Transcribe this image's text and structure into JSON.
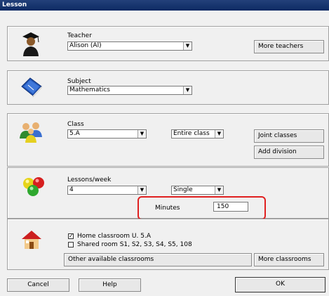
{
  "window": {
    "title": "Lesson"
  },
  "teacher": {
    "label": "Teacher",
    "selected": "Alison (Al)",
    "more_button": "More teachers",
    "icon": "teacher-icon"
  },
  "subject": {
    "label": "Subject",
    "selected": "Mathematics",
    "icon": "book-icon"
  },
  "class": {
    "label": "Class",
    "selected": "5.A",
    "scope_selected": "Entire class",
    "joint_button": "Joint classes",
    "division_button": "Add division",
    "icon": "students-icon"
  },
  "lessons": {
    "label": "Lessons/week",
    "count_selected": "4",
    "type_selected": "Single",
    "minutes_label": "Minutes",
    "minutes_value": "150",
    "icon": "balls-icon"
  },
  "rooms": {
    "home_checked": true,
    "home_label": "Home classroom U. 5.A",
    "shared_checked": false,
    "shared_label": "Shared room S1, S2, S3, S4, S5, 108",
    "other_button": "Other available classrooms",
    "more_button": "More classrooms",
    "icon": "house-icon"
  },
  "footer": {
    "cancel": "Cancel",
    "help": "Help",
    "ok": "OK"
  },
  "colors": {
    "titlebar": "#0d2a63",
    "highlight": "#e02020",
    "dialog_bg": "#f0f0f0"
  }
}
